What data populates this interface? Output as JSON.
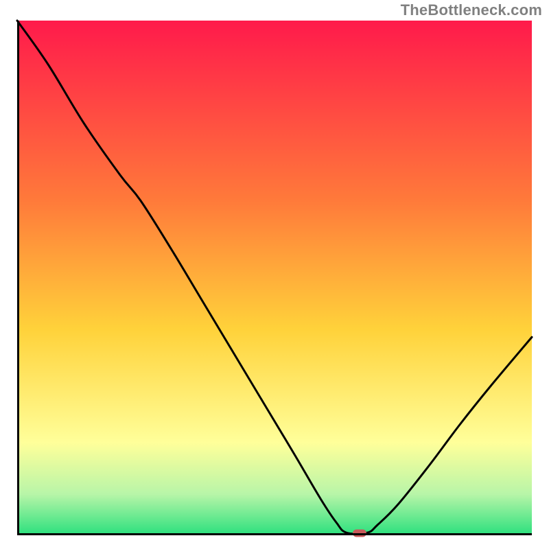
{
  "watermark_text": "TheBottleneck.com",
  "colors": {
    "gradient_top": "#ff1a4b",
    "gradient_mid1": "#ff7a3a",
    "gradient_mid2": "#ffd23a",
    "gradient_pale": "#ffff9a",
    "gradient_green_light": "#b8f5a8",
    "gradient_green": "#2ae07d",
    "line": "#000000",
    "marker": "#c85a5a",
    "frame": "#000000"
  },
  "chart_data": {
    "type": "line",
    "title": "",
    "xlabel": "",
    "ylabel": "",
    "marker": {
      "x": 0.665,
      "y": 0.0
    },
    "series": [
      {
        "name": "curve",
        "points": [
          {
            "x": 0.0,
            "y": 1.0
          },
          {
            "x": 0.06,
            "y": 0.915
          },
          {
            "x": 0.13,
            "y": 0.8
          },
          {
            "x": 0.2,
            "y": 0.7
          },
          {
            "x": 0.24,
            "y": 0.65
          },
          {
            "x": 0.3,
            "y": 0.555
          },
          {
            "x": 0.36,
            "y": 0.455
          },
          {
            "x": 0.42,
            "y": 0.355
          },
          {
            "x": 0.48,
            "y": 0.255
          },
          {
            "x": 0.54,
            "y": 0.155
          },
          {
            "x": 0.59,
            "y": 0.07
          },
          {
            "x": 0.62,
            "y": 0.025
          },
          {
            "x": 0.64,
            "y": 0.005
          },
          {
            "x": 0.68,
            "y": 0.005
          },
          {
            "x": 0.7,
            "y": 0.02
          },
          {
            "x": 0.74,
            "y": 0.06
          },
          {
            "x": 0.8,
            "y": 0.135
          },
          {
            "x": 0.86,
            "y": 0.215
          },
          {
            "x": 0.92,
            "y": 0.29
          },
          {
            "x": 1.0,
            "y": 0.385
          }
        ]
      }
    ],
    "xlim": [
      0,
      1
    ],
    "ylim": [
      0,
      1
    ]
  }
}
